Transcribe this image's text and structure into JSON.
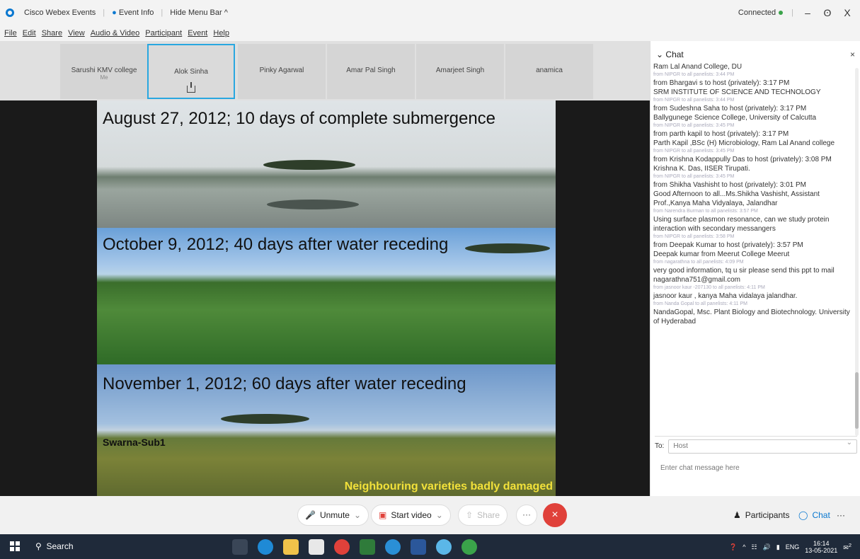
{
  "window": {
    "app_name": "Cisco Webex Events",
    "event_info": "Event Info",
    "hide_menu": "Hide Menu Bar ^",
    "status": "Connected",
    "minimize": "–",
    "restore": "ʘ",
    "close": "X"
  },
  "menu": [
    "File",
    "Edit",
    "Share",
    "View",
    "Audio & Video",
    "Participant",
    "Event",
    "Help"
  ],
  "participants": [
    {
      "name": "Sarushi KMV college",
      "sub": "Me"
    },
    {
      "name": "Alok Sinha",
      "sub": ""
    },
    {
      "name": "Pinky Agarwal",
      "sub": ""
    },
    {
      "name": "Amar Pal Singh",
      "sub": ""
    },
    {
      "name": "Amarjeet Singh",
      "sub": ""
    },
    {
      "name": "anamica",
      "sub": ""
    }
  ],
  "slide": {
    "caption1": "August 27, 2012; 10 days of complete submergence",
    "caption2": "October 9, 2012; 40 days after water receding",
    "caption3": "November 1, 2012; 60 days after water receding",
    "label_variety": "Swarna-Sub1",
    "label_damage": "Neighbouring varieties badly damaged"
  },
  "chat": {
    "title": "Chat",
    "close": "×",
    "messages": [
      {
        "from": "Ram Lal Anand College, DU",
        "meta": "from NIPGR to all panelists:   3:44 PM",
        "text": ""
      },
      {
        "from": "from Bhargavi s to host (privately):   3:17 PM",
        "meta": "",
        "text": "SRM INSTITUTE OF SCIENCE AND TECHNOLOGY"
      },
      {
        "from": "",
        "meta": "from NIPGR to all panelists:   3:44 PM",
        "text": ""
      },
      {
        "from": "from Sudeshna Saha to host (privately):   3:17 PM",
        "meta": "",
        "text": "Ballygunege Science College, University of Calcutta"
      },
      {
        "from": "",
        "meta": "from NIPGR to all panelists:   3:45 PM",
        "text": ""
      },
      {
        "from": "from parth kapil to host (privately):   3:17 PM",
        "meta": "",
        "text": "Parth Kapil ,BSc (H) Microbiology, Ram Lal Anand college"
      },
      {
        "from": "",
        "meta": "from NIPGR to all panelists:   3:45 PM",
        "text": ""
      },
      {
        "from": "from Krishna Kodappully Das to host (privately):   3:08 PM",
        "meta": "",
        "text": "Krishna K. Das, IISER Tirupati."
      },
      {
        "from": "",
        "meta": "from NIPGR to all panelists:   3:45 PM",
        "text": ""
      },
      {
        "from": "from Shikha Vashisht to host (privately):   3:01 PM",
        "meta": "",
        "text": "Good Afternoon to all...Ms.Shikha Vashisht, Assistant Prof.,Kanya Maha Vidyalaya, Jalandhar"
      },
      {
        "from": "",
        "meta": "from Narendra Burman to all panelists:   3:57 PM",
        "text": "Using surface plasmon resonance, can we study protein interaction with secondary messangers"
      },
      {
        "from": "",
        "meta": "from NIPGR to all panelists:   3:58 PM",
        "text": ""
      },
      {
        "from": "from Deepak Kumar to host (privately):   3:57 PM",
        "meta": "",
        "text": "Deepak kumar from Meerut College Meerut"
      },
      {
        "from": "",
        "meta": "from nagarathna to all panelists:   4:09 PM",
        "text": "very good information, tq u sir please send  this ppt to mail nagarathna751@gmail.com"
      },
      {
        "from": "",
        "meta": "from jasnoor kaur -207130 to all panelists:   4:11 PM",
        "text": "jasnoor kaur , kanya Maha vidalaya jalandhar."
      },
      {
        "from": "",
        "meta": "from Nanda Gopal to all panelists:   4:11 PM",
        "text": "NandaGopal, Msc. Plant Biology and Biotechnology. University of Hyderabad"
      }
    ],
    "to_label": "To:",
    "to_value": "Host",
    "input_placeholder": "Enter chat message here"
  },
  "controls": {
    "unmute": "Unmute",
    "start_video": "Start video",
    "share": "Share",
    "more": "···",
    "end": "×",
    "participants": "Participants",
    "chat": "Chat",
    "overflow": "···"
  },
  "taskbar": {
    "search": "Search",
    "lang": "ENG",
    "time": "16:14",
    "date": "13-05-2021",
    "notif_count": "2"
  }
}
